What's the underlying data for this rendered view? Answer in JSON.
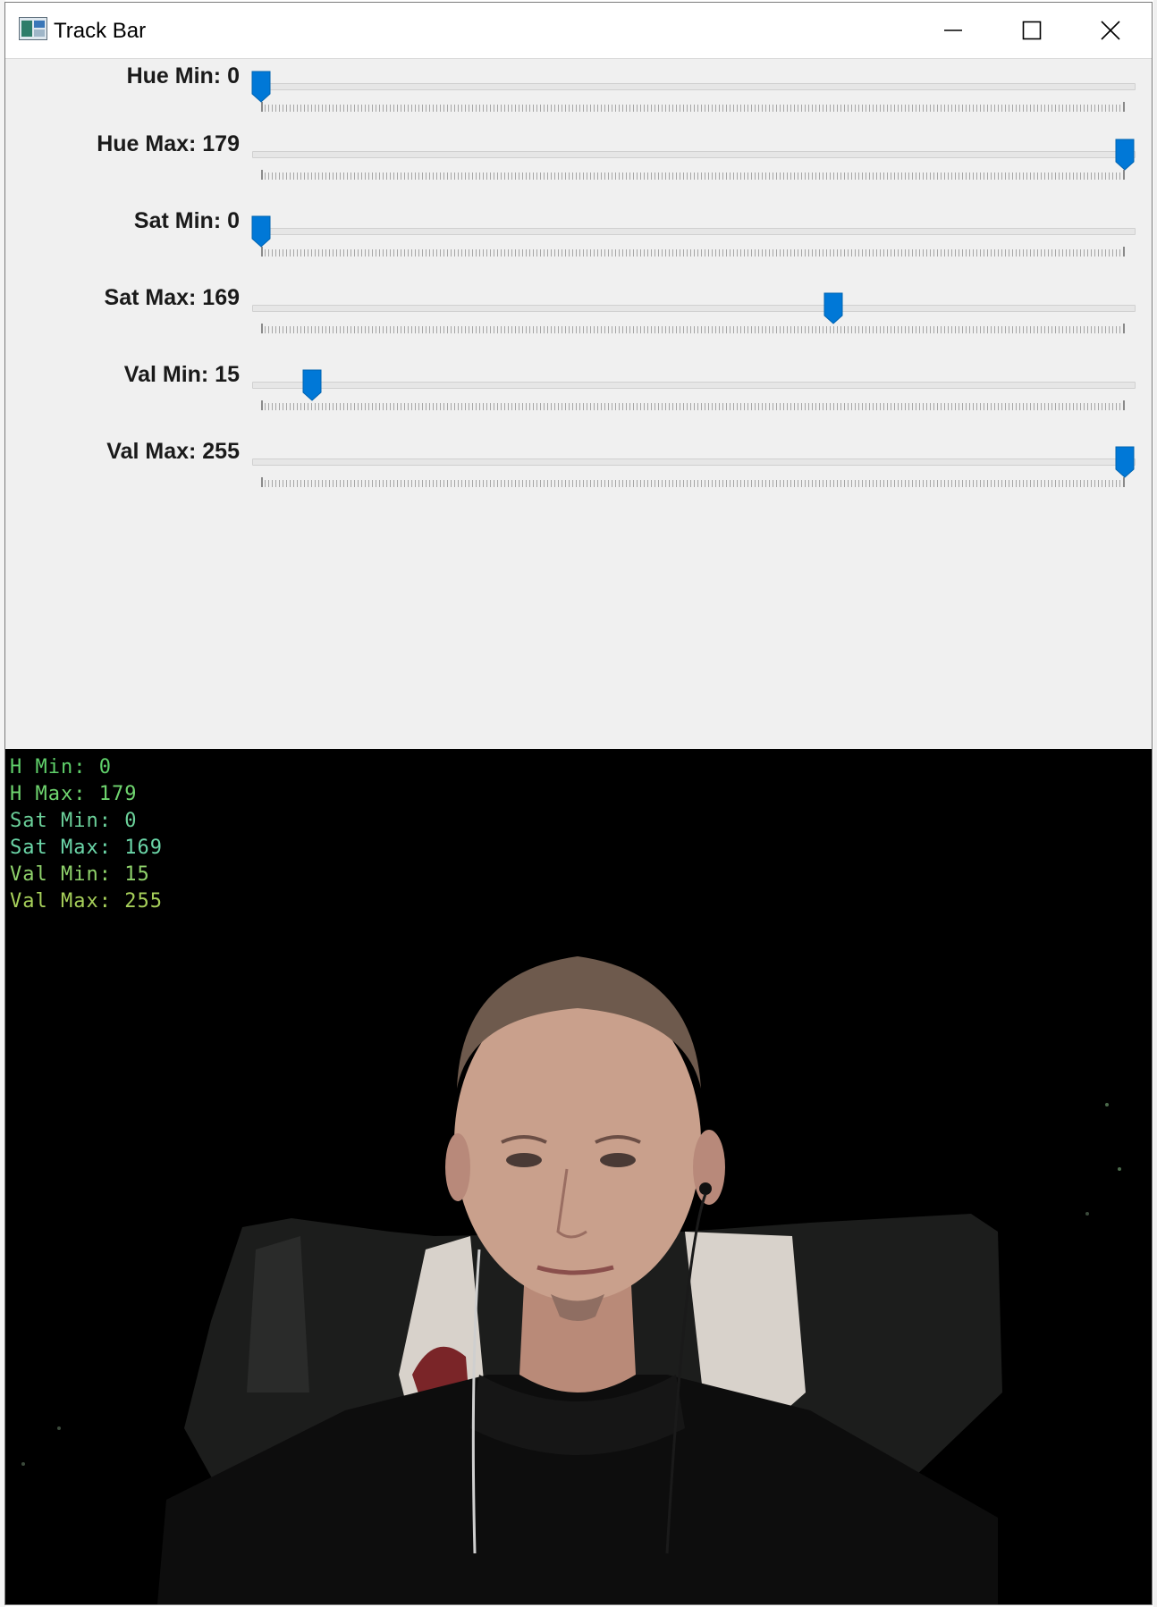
{
  "window": {
    "title": "Track Bar",
    "icon": "opencv-window-icon",
    "controls": [
      "minimize-icon",
      "maximize-icon",
      "close-icon"
    ]
  },
  "trackbars": [
    {
      "label": "Hue Min: 0",
      "value": 0,
      "max": 179,
      "fraction": 0.0
    },
    {
      "label": "Hue Max: 179",
      "value": 179,
      "max": 179,
      "fraction": 1.0
    },
    {
      "label": "Sat Min: 0",
      "value": 0,
      "max": 255,
      "fraction": 0.0
    },
    {
      "label": "Sat Max: 169",
      "value": 169,
      "max": 255,
      "fraction": 0.6627
    },
    {
      "label": "Val Min: 15",
      "value": 15,
      "max": 255,
      "fraction": 0.0588
    },
    {
      "label": "Val Max: 255",
      "value": 255,
      "max": 255,
      "fraction": 1.0
    }
  ],
  "overlay": [
    {
      "text": "H Min: 0",
      "color": "#5fd06a"
    },
    {
      "text": "H Max: 179",
      "color": "#6fd56f"
    },
    {
      "text": "Sat Min: 0",
      "color": "#6bd19a"
    },
    {
      "text": "Sat Max: 169",
      "color": "#6bd6a8"
    },
    {
      "text": "Val Min: 15",
      "color": "#8fd26b"
    },
    {
      "text": "Val Max: 255",
      "color": "#a7d05a"
    }
  ],
  "colors": {
    "thumb": "#0078d7",
    "panel_bg": "#f0f0f0",
    "video_bg": "#000000"
  }
}
